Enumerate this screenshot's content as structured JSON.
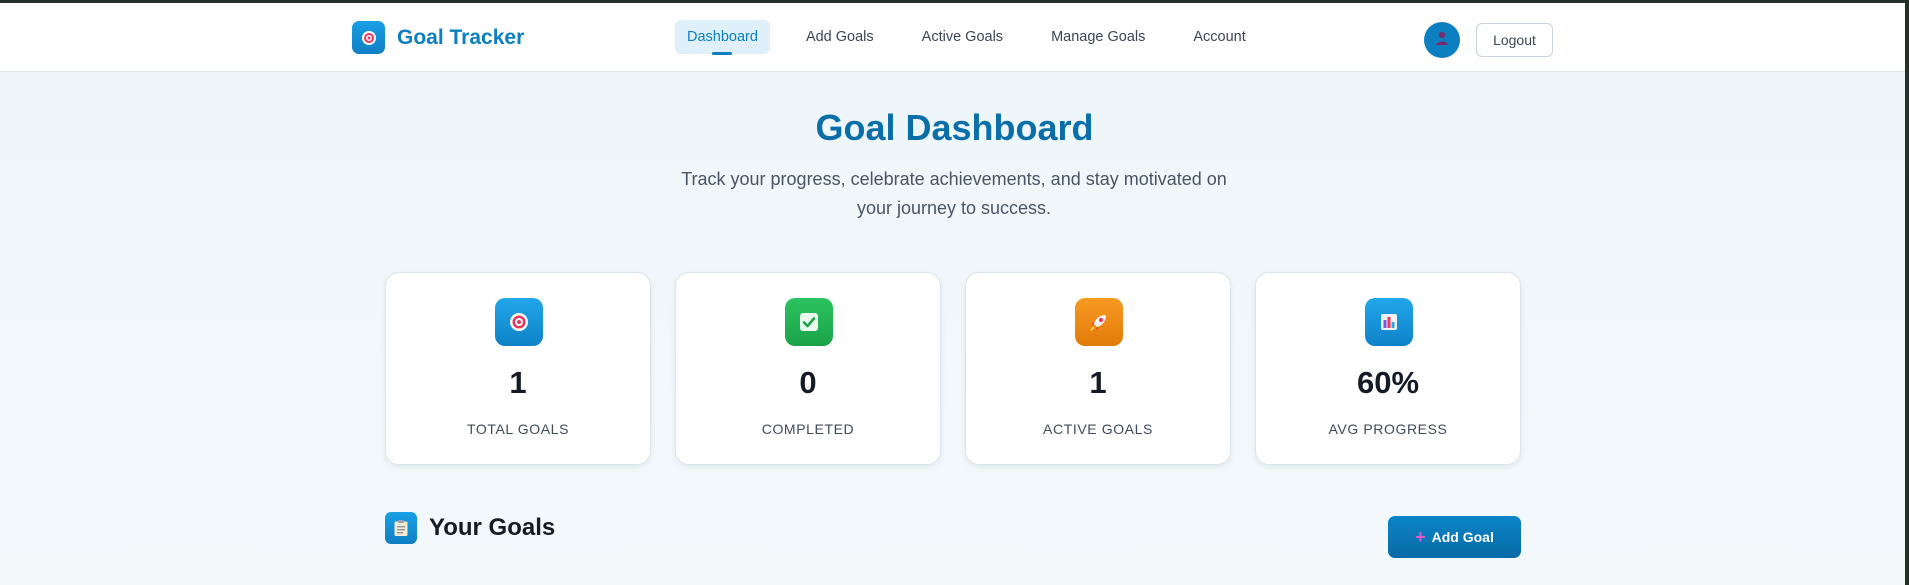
{
  "navbar": {
    "brand": {
      "name": "Goal Tracker",
      "logo_icon": "target-icon"
    },
    "links": [
      {
        "label": "Dashboard",
        "active": true
      },
      {
        "label": "Add Goals",
        "active": false
      },
      {
        "label": "Active Goals",
        "active": false
      },
      {
        "label": "Manage Goals",
        "active": false
      },
      {
        "label": "Account",
        "active": false
      }
    ],
    "avatar_icon": "user-icon",
    "logout_label": "Logout"
  },
  "hero": {
    "title": "Goal Dashboard",
    "subtitle_line1": "Track your progress, celebrate achievements, and stay motivated on",
    "subtitle_line2": "your journey to success."
  },
  "stats": [
    {
      "value": "1",
      "label": "TOTAL GOALS",
      "icon": "target-icon",
      "color": "#1a9be0"
    },
    {
      "value": "0",
      "label": "COMPLETED",
      "icon": "check-icon",
      "color": "#22b454"
    },
    {
      "value": "1",
      "label": "ACTIVE GOALS",
      "icon": "rocket-icon",
      "color": "#f08a12"
    },
    {
      "value": "60%",
      "label": "AVG PROGRESS",
      "icon": "bar-chart-icon",
      "color": "#1a9be0"
    }
  ],
  "goals_section": {
    "title": "Your Goals",
    "icon": "clipboard-icon",
    "add_button_label": "Add Goal"
  },
  "colors": {
    "primary": "#0b7fbf",
    "title": "#0a6fa8",
    "success": "#22b454",
    "warning": "#f08a12"
  }
}
